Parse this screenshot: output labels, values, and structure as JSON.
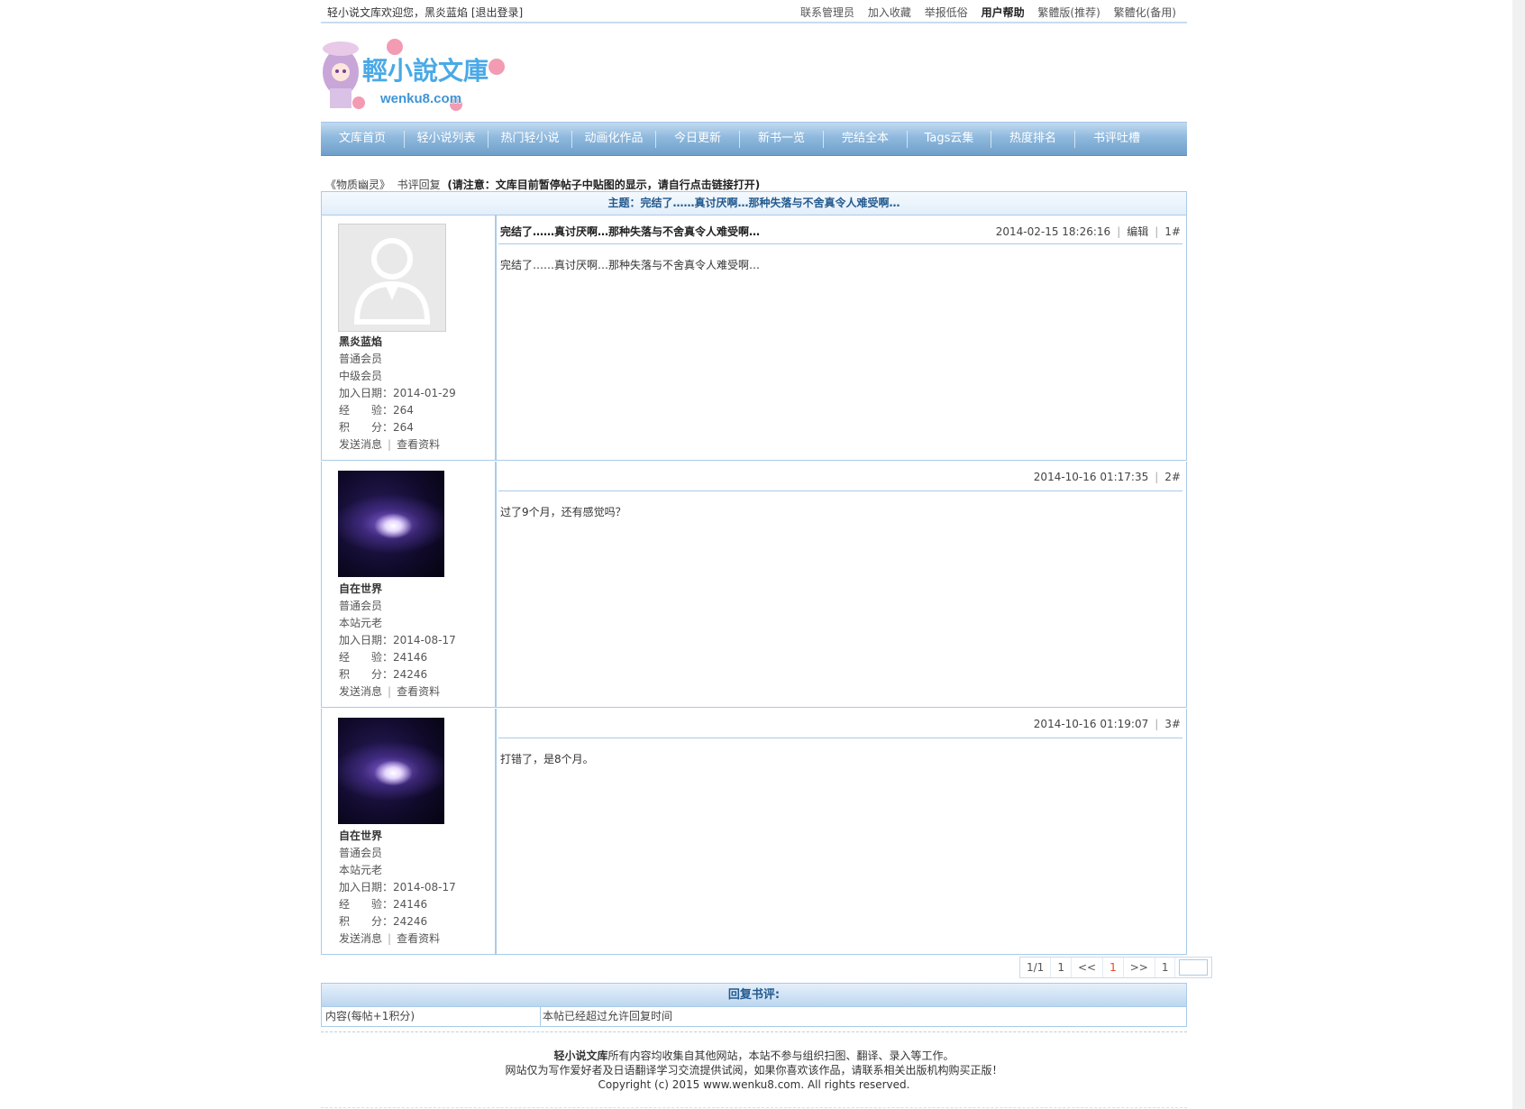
{
  "topbar": {
    "welcome": "轻小说文库欢迎您，黑炎蓝焰 [退出登录]",
    "links": [
      "联系管理员",
      "加入收藏",
      "举报低俗",
      "用户帮助",
      "繁體版(推荐)",
      "繁體化(备用)"
    ]
  },
  "logo": {
    "text": "輕小說文庫",
    "sub": "wenku8.com"
  },
  "nav": [
    "文库首页",
    "轻小说列表",
    "热门轻小说",
    "动画化作品",
    "今日更新",
    "新书一览",
    "完结全本",
    "Tags云集",
    "热度排名",
    "书评吐槽"
  ],
  "breadcrumb": {
    "book": "《物质幽灵》",
    "section": "书评回复",
    "notice": "(请注意：文库目前暂停帖子中贴图的显示，请自行点击链接打开)"
  },
  "topic": "主题：完结了……真讨厌啊…那种失落与不舍真令人难受啊…",
  "labels": {
    "join": "加入日期：",
    "exp": "经　　验：",
    "score": "积　　分：",
    "send": "发送消息",
    "profile": "查看资料",
    "edit": "编辑"
  },
  "posts": [
    {
      "user": "黑炎蓝焰",
      "group": "普通会员",
      "level": "中级会员",
      "join": "2014-01-29",
      "exp": "264",
      "score": "264",
      "title": "完结了……真讨厌啊…那种失落与不舍真令人难受啊…",
      "time": "2014-02-15 18:26:16",
      "floor": "1#",
      "body": "完结了……真讨厌啊…那种失落与不舍真令人难受啊…"
    },
    {
      "user": "自在世界",
      "group": "普通会员",
      "level": "本站元老",
      "join": "2014-08-17",
      "exp": "24146",
      "score": "24246",
      "title": "",
      "time": "2014-10-16 01:17:35",
      "floor": "2#",
      "body": "过了9个月，还有感觉吗？"
    },
    {
      "user": "自在世界",
      "group": "普通会员",
      "level": "本站元老",
      "join": "2014-08-17",
      "exp": "24146",
      "score": "24246",
      "title": "",
      "time": "2014-10-16 01:19:07",
      "floor": "3#",
      "body": "打错了，是8个月。"
    }
  ],
  "pager": {
    "pages": "1/1",
    "first": "1",
    "prev": "<<",
    "current": "1",
    "next": ">>",
    "last": "1"
  },
  "reply": {
    "header": "回复书评:",
    "content_label": "内容(每帖+1积分)",
    "message": "本帖已经超过允许回复时间"
  },
  "footer": {
    "site": "轻小说文库",
    "line1_rest": "所有内容均收集自其他网站，本站不参与组织扫图、翻译、录入等工作。",
    "line2": "网站仅为写作爱好者及日语翻译学习交流提供试阅，如果你喜欢该作品，请联系相关出版机构购买正版！",
    "line3": "Copyright (c) 2015 www.wenku8.com. All rights reserved."
  },
  "colors": {
    "accent": "#245a8f",
    "border": "#a9cbe8",
    "nav": "#8fb9dd",
    "pager_current": "#e44a1b"
  }
}
